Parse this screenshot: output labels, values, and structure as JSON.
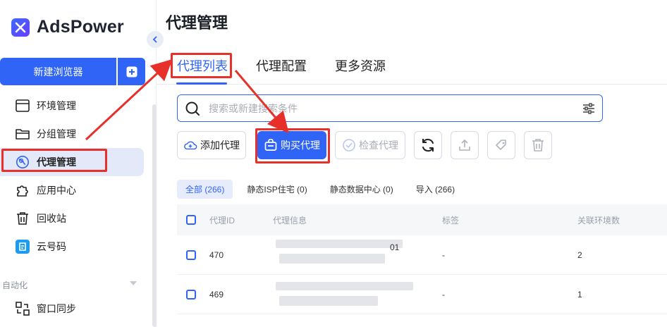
{
  "app": {
    "logo_text": "AdsPower"
  },
  "sidebar": {
    "new_browser_label": "新建浏览器",
    "items": [
      {
        "label": "环境管理",
        "icon": "window-icon"
      },
      {
        "label": "分组管理",
        "icon": "folder-icon"
      },
      {
        "label": "代理管理",
        "icon": "proxy-globe-icon",
        "active": true
      },
      {
        "label": "应用中心",
        "icon": "puzzle-icon"
      },
      {
        "label": "回收站",
        "icon": "trash-icon"
      },
      {
        "label": "云号码",
        "icon": "cloud-number-icon"
      }
    ],
    "section_automation": "自动化",
    "sync_label": "窗口同步"
  },
  "page": {
    "title": "代理管理",
    "tabs": [
      "代理列表",
      "代理配置",
      "更多资源"
    ],
    "active_tab": 0
  },
  "search": {
    "placeholder": "搜索或新建搜索条件"
  },
  "toolbar": {
    "add_proxy": "添加代理",
    "buy_proxy": "购买代理",
    "check_proxy": "检查代理"
  },
  "filters": [
    "全部 (266)",
    "静态ISP住宅 (0)",
    "静态数据中心 (0)",
    "导入 (266)"
  ],
  "table": {
    "columns": [
      "代理ID",
      "代理信息",
      "标签",
      "关联环境数"
    ],
    "rows": [
      {
        "id": "470",
        "info_partial": "01",
        "tag": "-",
        "count": "2"
      },
      {
        "id": "469",
        "info_partial": "",
        "tag": "-",
        "count": "1"
      }
    ]
  },
  "colors": {
    "accent": "#2f64f6",
    "annotation": "#e8302a"
  }
}
